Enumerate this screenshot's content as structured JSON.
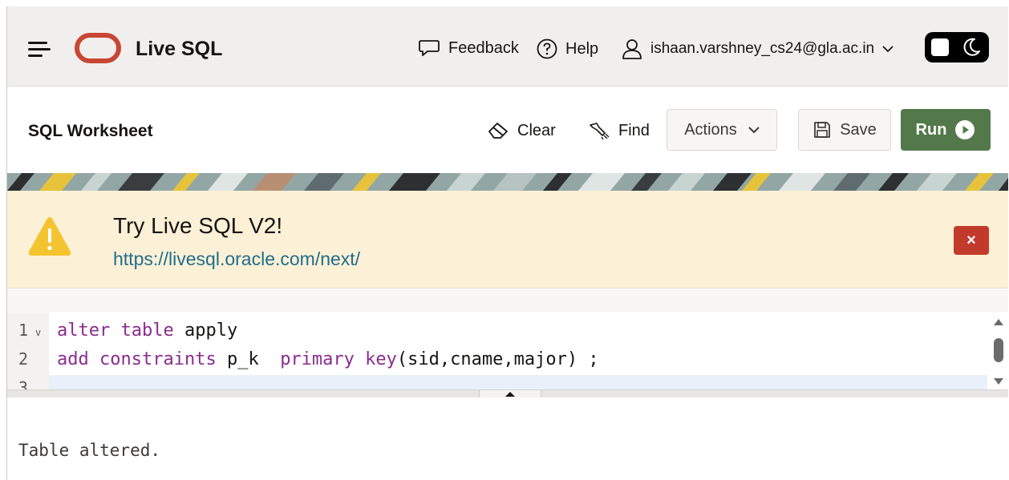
{
  "header": {
    "app_title": "Live SQL",
    "feedback_label": "Feedback",
    "help_label": "Help",
    "user_email": "ishaan.varshney_cs24@gla.ac.in",
    "menu_icon": "hamburger-menu-icon",
    "logo": "oracle-logo"
  },
  "toolbar": {
    "title": "SQL Worksheet",
    "clear_label": "Clear",
    "find_label": "Find",
    "actions_label": "Actions",
    "save_label": "Save",
    "run_label": "Run"
  },
  "banner": {
    "title": "Try Live SQL V2!",
    "link": "https://livesql.oracle.com/next/",
    "close_label": "×"
  },
  "editor": {
    "line_numbers": [
      "1",
      "2",
      "3"
    ],
    "lines": [
      [
        {
          "t": "alter",
          "k": true
        },
        {
          "t": " ",
          "k": false
        },
        {
          "t": "table",
          "k": true
        },
        {
          "t": " apply",
          "k": false
        }
      ],
      [
        {
          "t": "add",
          "k": true
        },
        {
          "t": " ",
          "k": false
        },
        {
          "t": "constraints",
          "k": true
        },
        {
          "t": " p_k  ",
          "k": false
        },
        {
          "t": "primary",
          "k": true
        },
        {
          "t": " ",
          "k": false
        },
        {
          "t": "key",
          "k": true
        },
        {
          "t": "(sid,cname,major) ;",
          "k": false
        }
      ],
      []
    ]
  },
  "output": {
    "text": "Table altered."
  },
  "colors": {
    "header_bg": "#f1efed",
    "logo_red": "#c74634",
    "run_green": "#53794a",
    "banner_bg": "#fcf0d6",
    "warning_yellow": "#f4c430",
    "close_red": "#c23a2b",
    "link_blue": "#1e6e8c",
    "keyword_purple": "#8a2c8e"
  }
}
